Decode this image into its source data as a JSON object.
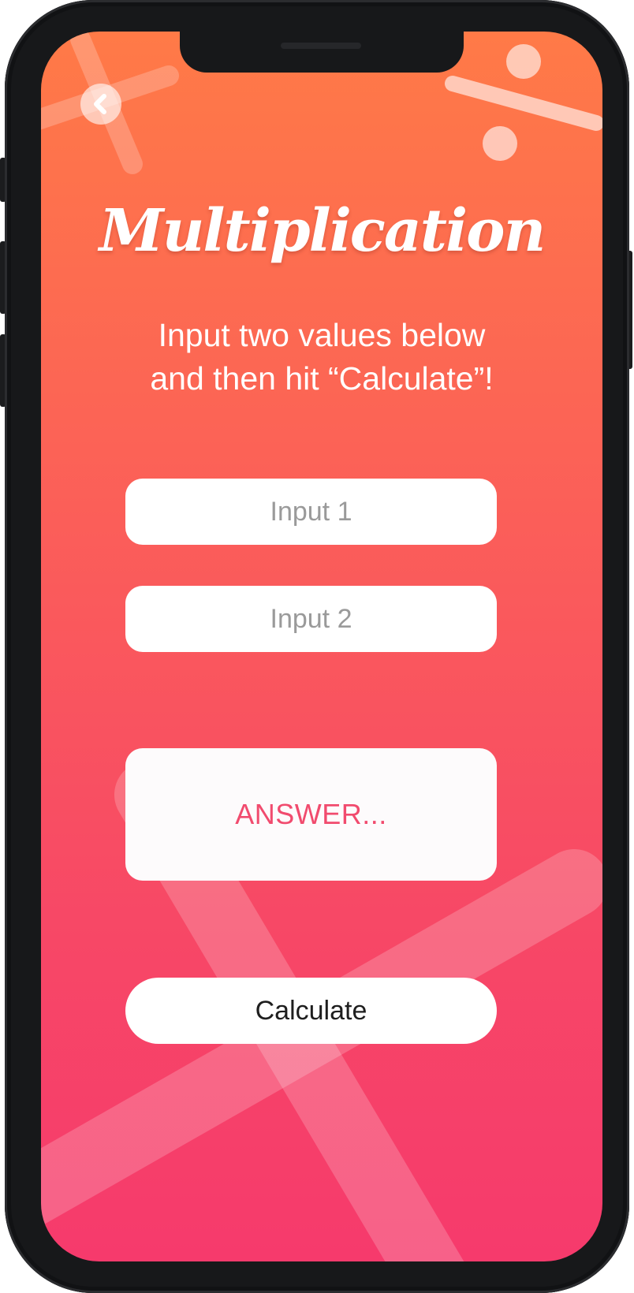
{
  "header": {
    "back_icon": "chevron-left-icon",
    "title": "Multiplication",
    "subtitle": "Input two values below\nand then hit “Calculate”!"
  },
  "form": {
    "input1_placeholder": "Input 1",
    "input2_placeholder": "Input 2",
    "answer_placeholder": "ANSWER...",
    "calculate_label": "Calculate"
  },
  "decorations": [
    "plus-icon",
    "divide-icon",
    "multiply-icon"
  ],
  "colors": {
    "gradient_top": "#ff7a47",
    "gradient_bottom": "#f63a6c",
    "answer_text": "#f14b6e",
    "field_background": "#ffffff"
  }
}
